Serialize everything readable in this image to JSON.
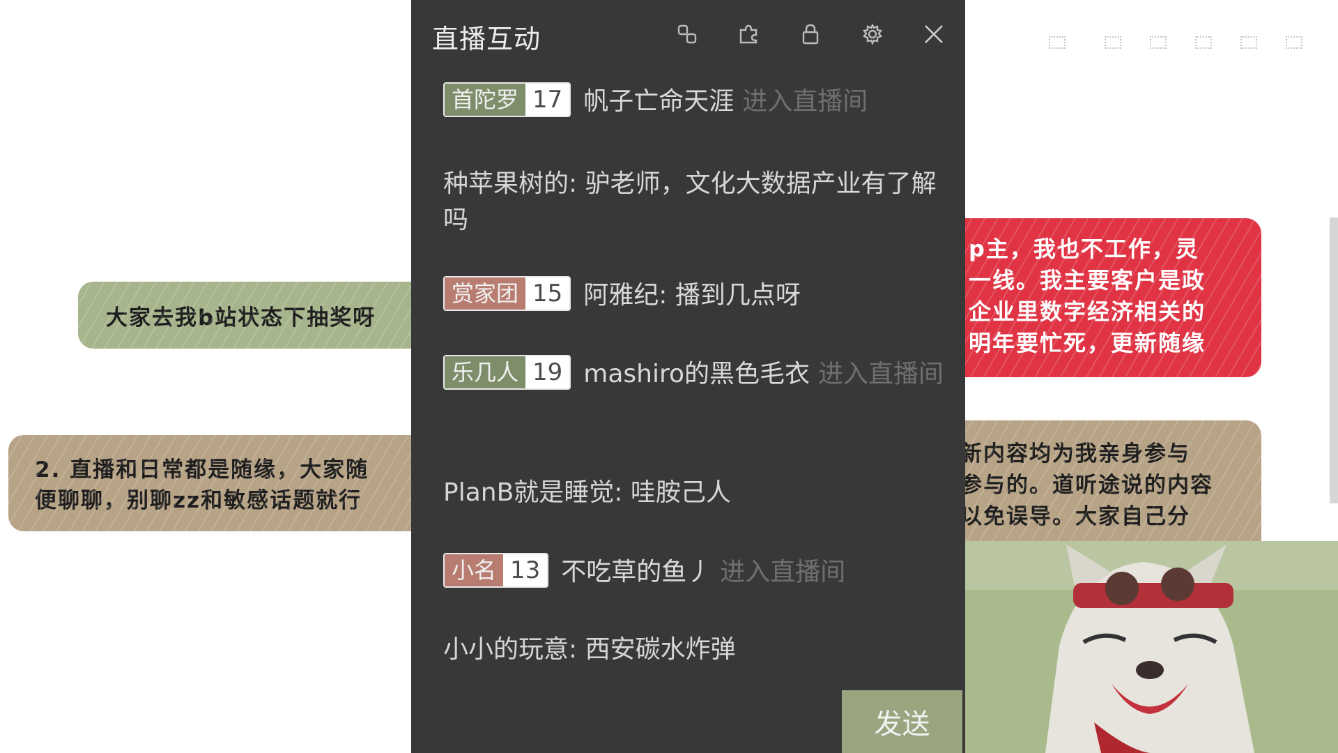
{
  "overlay": {
    "lottery_note": "大家去我b站状态下抽奖呀",
    "rules_note": [
      "2. 直播和日常都是随缘，大家随",
      "便聊聊，别聊zz和敏感话题就行"
    ],
    "intro_note": [
      "p主，我也不工作，灵",
      "一线。我主要客户是政",
      "企业里数字经济相关的",
      "明年要忙死，更新随缘"
    ],
    "disclaimer_note": [
      "新内容均为我亲身参与",
      "参与的。道听途说的内容",
      "以免误导。大家自己分"
    ]
  },
  "panel": {
    "title": "直播互动",
    "icons": [
      "link-icon",
      "puzzle-icon",
      "lock-icon",
      "gear-icon",
      "close-icon"
    ],
    "send_label": "发送"
  },
  "messages": [
    {
      "badge": "首陀罗",
      "level": "17",
      "badge_color": "green",
      "user": "帆子亡命天涯",
      "action": "进入直播间"
    },
    {
      "text": "种苹果树的: 驴老师，文化大数据产业有了解吗"
    },
    {
      "badge": "赏家团",
      "level": "15",
      "badge_color": "red",
      "user": "阿雅纪: 播到几点呀"
    },
    {
      "badge": "乐几人",
      "level": "19",
      "badge_color": "green",
      "user": "mashiro的黑色毛衣",
      "action": "进入直播间"
    },
    {
      "text": "PlanB就是睡觉: 哇胺己人"
    },
    {
      "badge": "小名",
      "level": "13",
      "badge_color": "red",
      "user": "不吃草的鱼丿",
      "action": "进入直播间"
    },
    {
      "text": "小小的玩意: 西安碳水炸弹"
    }
  ]
}
